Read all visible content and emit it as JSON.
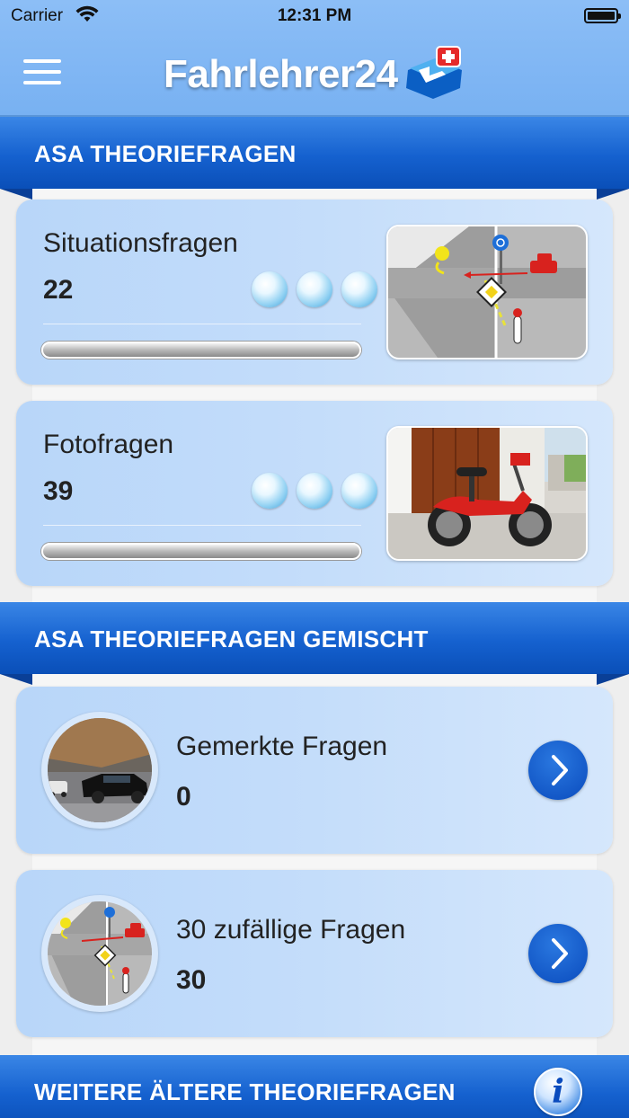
{
  "status_bar": {
    "carrier": "Carrier",
    "time": "12:31 PM"
  },
  "header": {
    "title": "Fahrlehrer24"
  },
  "sections": {
    "asa": "ASA THEORIEFRAGEN",
    "mixed": "ASA THEORIEFRAGEN GEMISCHT",
    "older": "WEITERE ÄLTERE THEORIEFRAGEN"
  },
  "categories": [
    {
      "title": "Situationsfragen",
      "count": "22",
      "progress": 0
    },
    {
      "title": "Fotofragen",
      "count": "39",
      "progress": 0
    }
  ],
  "mixed_items": [
    {
      "title": "Gemerkte Fragen",
      "count": "0"
    },
    {
      "title": "30 zufällige Fragen",
      "count": "30"
    }
  ],
  "colors": {
    "header_bg": "#7fb5f4",
    "banner_blue": "#1561cf",
    "card_bg": "#c4ddfa",
    "button_blue": "#0a4bbd"
  },
  "icons": [
    "menu-icon",
    "wifi-icon",
    "battery-icon",
    "chevron-right-icon",
    "info-icon",
    "logo-icon"
  ]
}
